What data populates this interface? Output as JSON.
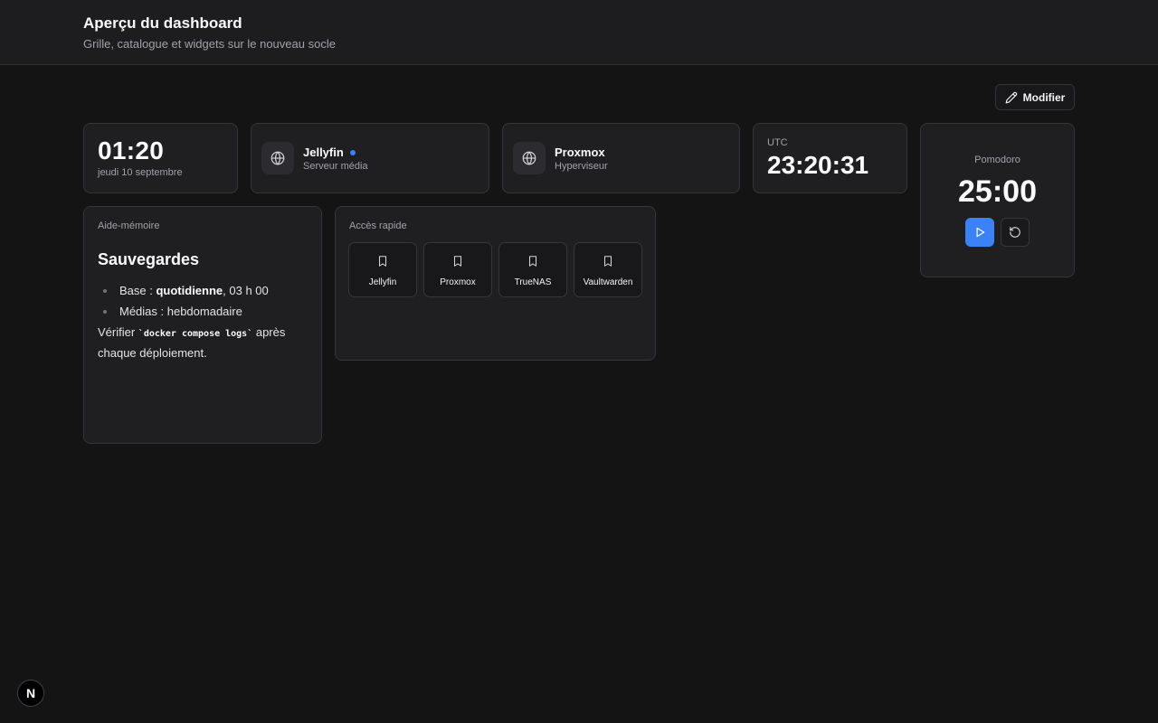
{
  "header": {
    "title": "Aperçu du dashboard",
    "subtitle": "Grille, catalogue et widgets sur le nouveau socle"
  },
  "toolbar": {
    "edit_label": "Modifier"
  },
  "clock": {
    "time": "01:20",
    "date": "jeudi 10 septembre"
  },
  "services": [
    {
      "name": "Jellyfin",
      "description": "Serveur média",
      "status_color": "#3b82f6",
      "icon": "globe-icon"
    },
    {
      "name": "Proxmox",
      "description": "Hyperviseur",
      "icon": "globe-icon"
    }
  ],
  "utc_clock": {
    "label": "UTC",
    "time": "23:20:31"
  },
  "pomodoro": {
    "label": "Pomodoro",
    "time": "25:00",
    "play_icon": "play-icon",
    "reset_icon": "reset-icon",
    "accent": "#3b82f6"
  },
  "memo": {
    "label": "Aide-mémoire",
    "title": "Sauvegardes",
    "items": [
      {
        "prefix": "Base : ",
        "bold": "quotidienne",
        "suffix": ", 03 h 00"
      },
      {
        "prefix": "Médias : hebdomadaire",
        "bold": "",
        "suffix": ""
      }
    ],
    "note_before": "Vérifier ",
    "note_code": "`docker compose logs`",
    "note_after": " après chaque déploiement."
  },
  "quick_access": {
    "label": "Accès rapide",
    "links": [
      {
        "label": "Jellyfin",
        "icon": "bookmark-icon"
      },
      {
        "label": "Proxmox",
        "icon": "bookmark-icon"
      },
      {
        "label": "TrueNAS",
        "icon": "bookmark-icon"
      },
      {
        "label": "Vaultwarden",
        "icon": "bookmark-icon"
      }
    ]
  },
  "dev_badge": {
    "letter": "N"
  }
}
